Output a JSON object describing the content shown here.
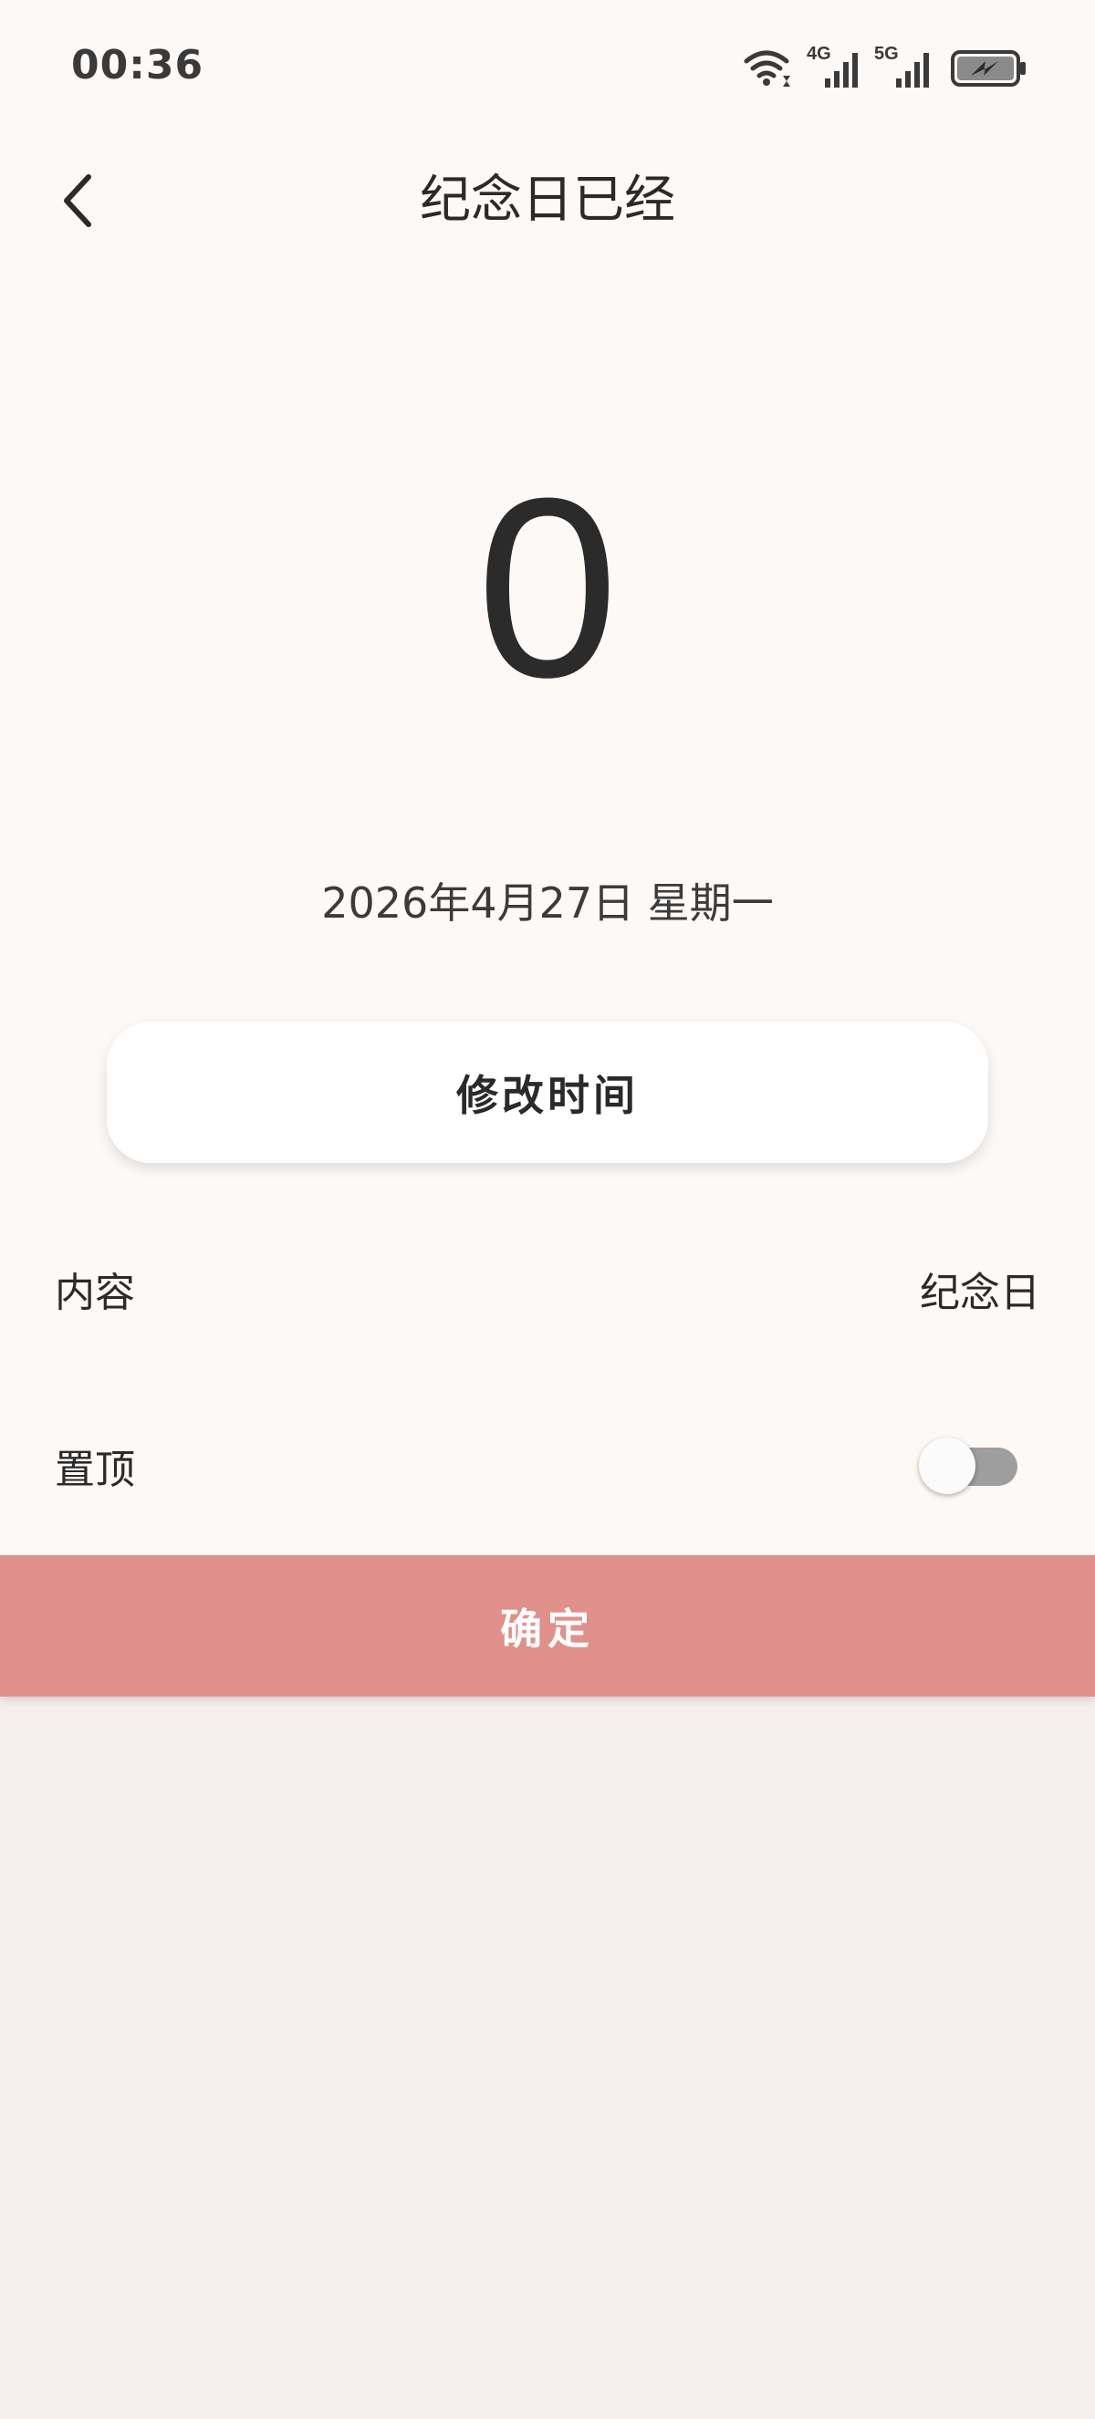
{
  "status_bar": {
    "time": "00:36",
    "network_1": "4G",
    "network_2": "5G",
    "icons": [
      "wifi-icon",
      "signal-4g-icon",
      "signal-5g-icon",
      "battery-charging-icon"
    ]
  },
  "header": {
    "title": "纪念日已经",
    "back_icon": "chevron-left-icon"
  },
  "counter": {
    "days": "0",
    "date": "2026年4月27日 星期一"
  },
  "modify_button": {
    "label": "修改时间"
  },
  "settings": {
    "content_label": "内容",
    "content_value": "纪念日",
    "pin_label": "置顶",
    "pin_enabled": false
  },
  "confirm_button": {
    "label": "确定"
  },
  "colors": {
    "background": "#fdf9f7",
    "lower_background": "#f4eeee",
    "confirm": "#e0908b",
    "text": "#2a2a2a",
    "toggle_track": "#9e9e9e"
  }
}
